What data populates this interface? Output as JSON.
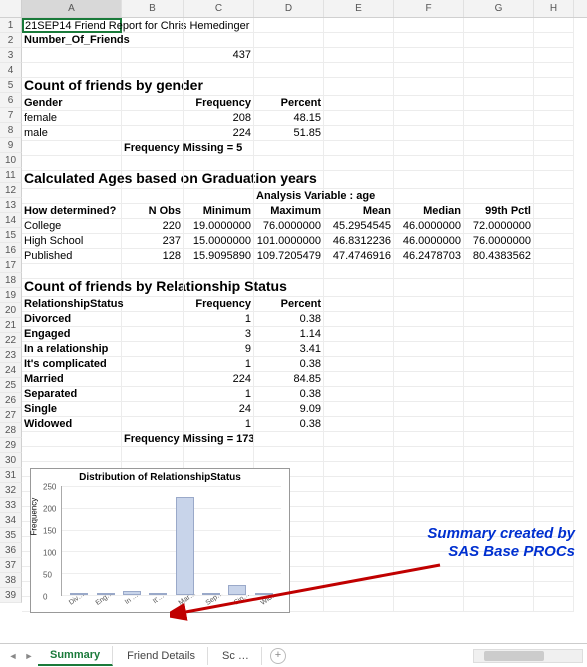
{
  "columns": [
    "A",
    "B",
    "C",
    "D",
    "E",
    "F",
    "G",
    "H"
  ],
  "title_cell": "21SEP14 Friend Report for Chris Hemedinger",
  "num_friends_label": "Number_Of_Friends",
  "num_friends_value": "437",
  "gender": {
    "title": "Count of friends by gender",
    "h1": "Gender",
    "h2": "Frequency",
    "h3": "Percent",
    "rows": [
      {
        "g": "female",
        "f": "208",
        "p": "48.15"
      },
      {
        "g": "male",
        "f": "224",
        "p": "51.85"
      }
    ],
    "missing": "Frequency Missing = 5"
  },
  "ages": {
    "title": "Calculated Ages based on Graduation years",
    "subtitle": "Analysis Variable : age",
    "h_det": "How determined?",
    "h_obs": "N Obs",
    "h_min": "Minimum",
    "h_max": "Maximum",
    "h_mean": "Mean",
    "h_med": "Median",
    "h_99": "99th Pctl",
    "rows": [
      {
        "d": "College",
        "n": "220",
        "min": "19.0000000",
        "max": "76.0000000",
        "mean": "45.2954545",
        "med": "46.0000000",
        "p99": "72.0000000"
      },
      {
        "d": "High School",
        "n": "237",
        "min": "15.0000000",
        "max": "101.0000000",
        "mean": "46.8312236",
        "med": "46.0000000",
        "p99": "76.0000000"
      },
      {
        "d": "Published",
        "n": "128",
        "min": "15.9095890",
        "max": "109.7205479",
        "mean": "47.4746916",
        "med": "46.2478703",
        "p99": "80.4383562"
      }
    ]
  },
  "rel": {
    "title": "Count of friends by Relationship Status",
    "h1": "RelationshipStatus",
    "h2": "Frequency",
    "h3": "Percent",
    "rows": [
      {
        "s": "Divorced",
        "f": "1",
        "p": "0.38"
      },
      {
        "s": "Engaged",
        "f": "3",
        "p": "1.14"
      },
      {
        "s": "In a relationship",
        "f": "9",
        "p": "3.41"
      },
      {
        "s": "It's complicated",
        "f": "1",
        "p": "0.38"
      },
      {
        "s": "Married",
        "f": "224",
        "p": "84.85"
      },
      {
        "s": "Separated",
        "f": "1",
        "p": "0.38"
      },
      {
        "s": "Single",
        "f": "24",
        "p": "9.09"
      },
      {
        "s": "Widowed",
        "f": "1",
        "p": "0.38"
      }
    ],
    "missing": "Frequency Missing = 173"
  },
  "chart_data": {
    "type": "bar",
    "title": "Distribution of RelationshipStatus",
    "ylabel": "Frequency",
    "ylim": [
      0,
      250
    ],
    "yticks": [
      0,
      50,
      100,
      150,
      200,
      250
    ],
    "categories": [
      "Divorced",
      "Engaged",
      "In a relationship",
      "It's complicated",
      "Married",
      "Separated",
      "Single",
      "Widowed"
    ],
    "values": [
      1,
      3,
      9,
      1,
      224,
      1,
      24,
      1
    ]
  },
  "annotation": {
    "line1": "Summary created by",
    "line2": "SAS Base PROCs"
  },
  "tabs": {
    "t1": "Summary",
    "t2": "Friend Details",
    "t3": "Sc …"
  }
}
